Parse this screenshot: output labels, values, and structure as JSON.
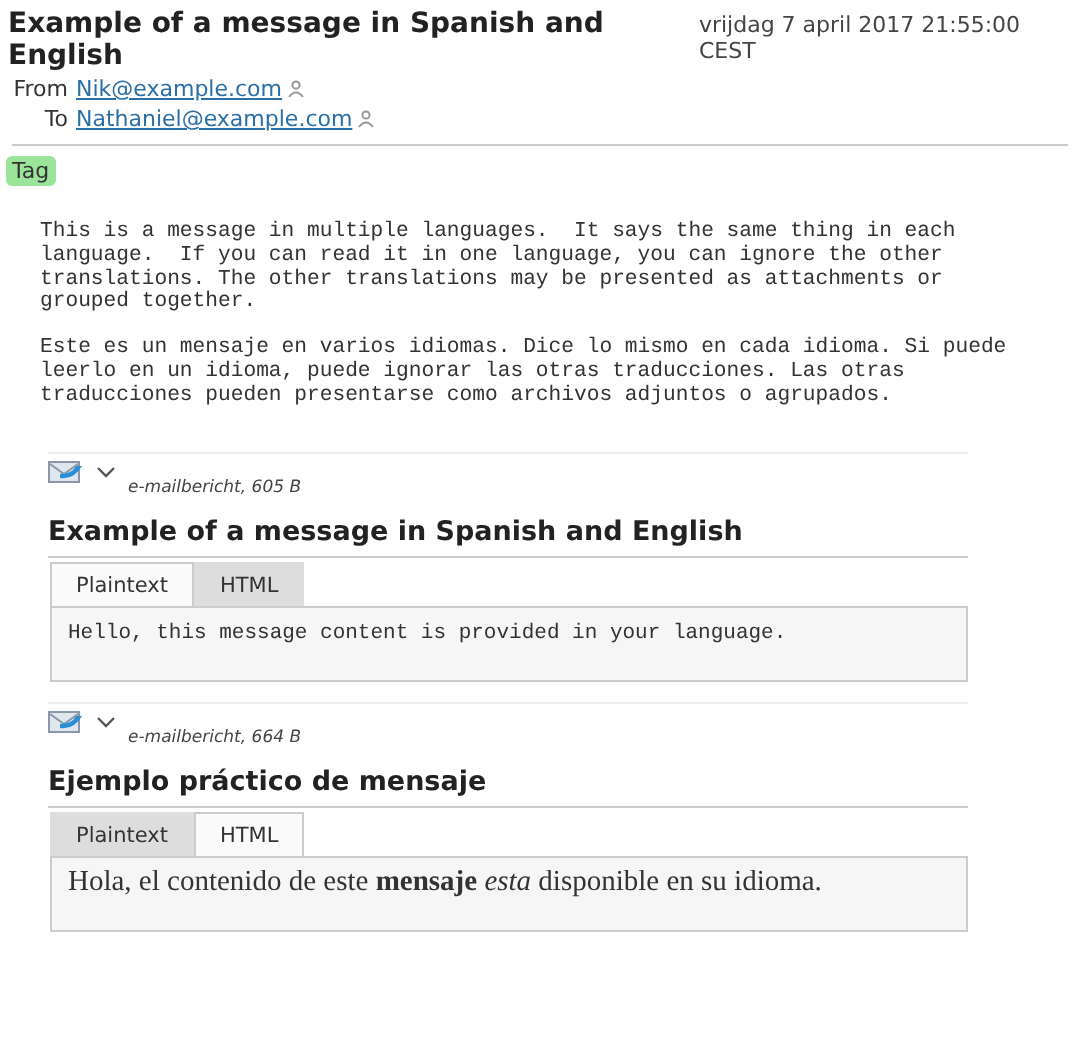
{
  "header": {
    "subject": "Example of a message in Spanish and English",
    "date": "vrijdag 7 april 2017 21:55:00 CEST",
    "fields": [
      {
        "label": "From",
        "address": "Nik@example.com"
      },
      {
        "label": "To",
        "address": "Nathaniel@example.com"
      }
    ]
  },
  "tags": [
    {
      "label": "Tag",
      "color": "#9be59b"
    }
  ],
  "body": [
    "This is a message in multiple languages.  It says the same thing in each\nlanguage.  If you can read it in one language, you can ignore the other\ntranslations. The other translations may be presented as attachments or\ngrouped together.",
    "Este es un mensaje en varios idiomas. Dice lo mismo en cada idioma. Si puede\nleerlo en un idioma, puede ignorar las otras traducciones. Las otras\ntraducciones pueden presentarse como archivos adjuntos o agrupados."
  ],
  "attachments": [
    {
      "meta": "e-mailbericht, 605 B",
      "title": "Example of a message in Spanish and English",
      "tabs": [
        {
          "label": "Plaintext",
          "selected": true
        },
        {
          "label": "HTML",
          "selected": false
        }
      ],
      "content": {
        "kind": "plain",
        "text": "Hello, this message content is provided in your language."
      }
    },
    {
      "meta": "e-mailbericht, 664 B",
      "title": "Ejemplo práctico de mensaje",
      "tabs": [
        {
          "label": "Plaintext",
          "selected": false
        },
        {
          "label": "HTML",
          "selected": true
        }
      ],
      "content": {
        "kind": "html",
        "text": "Hola, el contenido de este **mensaje** *esta* disponible en su idioma."
      }
    }
  ]
}
